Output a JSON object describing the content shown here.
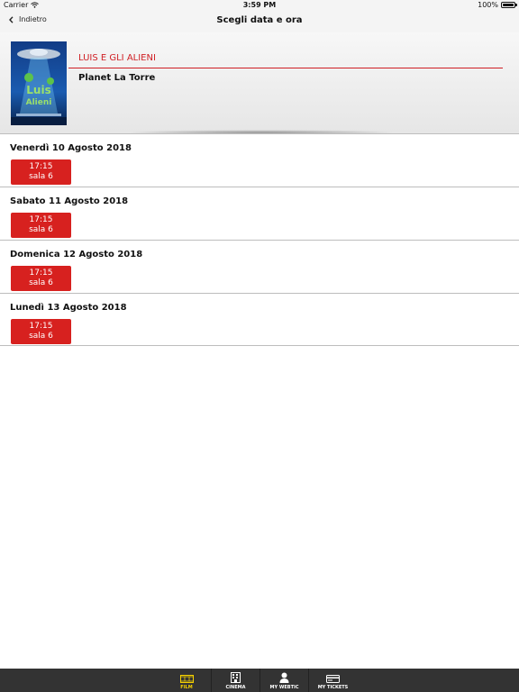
{
  "status_bar": {
    "carrier": "Carrier",
    "time": "3:59 PM",
    "battery": "100%"
  },
  "nav": {
    "back_label": "Indietro",
    "title": "Scegli data e ora"
  },
  "movie": {
    "title": "LUIS E GLI ALIENI",
    "cinema": "Planet La Torre",
    "poster_icon": "movie-poster-image"
  },
  "showings": [
    {
      "date": "Venerdì 10 Agosto 2018",
      "time": "17:15",
      "room": "sala 6"
    },
    {
      "date": "Sabato 11 Agosto 2018",
      "time": "17:15",
      "room": "sala 6"
    },
    {
      "date": "Domenica 12 Agosto 2018",
      "time": "17:15",
      "room": "sala 6"
    },
    {
      "date": "Lunedì 13 Agosto 2018",
      "time": "17:15",
      "room": "sala 6"
    }
  ],
  "tabs": [
    {
      "label": "FILM",
      "icon": "film-icon",
      "active": true
    },
    {
      "label": "CINEMA",
      "icon": "building-icon",
      "active": false
    },
    {
      "label": "MY WEBTIC",
      "icon": "user-icon",
      "active": false
    },
    {
      "label": "MY TICKETS",
      "icon": "ticket-icon",
      "active": false
    }
  ],
  "colors": {
    "accent_red": "#d7211f",
    "tab_active": "#f4d000",
    "tab_bar_bg": "#333333"
  }
}
